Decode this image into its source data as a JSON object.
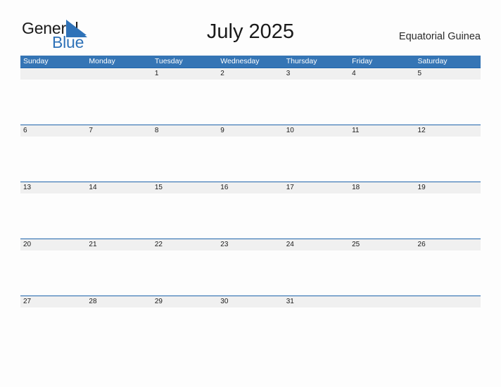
{
  "brand": {
    "name_part1": "General",
    "name_part2": "Blue",
    "flag_icon": "triangle-flag-icon",
    "accent_color": "#2e72b8"
  },
  "header": {
    "title": "July 2025",
    "region": "Equatorial Guinea"
  },
  "theme": {
    "header_row_bg": "#3575b5",
    "rule_color": "#1f64ab",
    "band_bg": "#f0f0f0",
    "page_bg": "#fdfdfd",
    "text_color": "#1a1a1a"
  },
  "calendar": {
    "month": "July",
    "year": "2025",
    "weekdays": [
      "Sunday",
      "Monday",
      "Tuesday",
      "Wednesday",
      "Thursday",
      "Friday",
      "Saturday"
    ],
    "weeks": [
      [
        "",
        "",
        "1",
        "2",
        "3",
        "4",
        "5"
      ],
      [
        "6",
        "7",
        "8",
        "9",
        "10",
        "11",
        "12"
      ],
      [
        "13",
        "14",
        "15",
        "16",
        "17",
        "18",
        "19"
      ],
      [
        "20",
        "21",
        "22",
        "23",
        "24",
        "25",
        "26"
      ],
      [
        "27",
        "28",
        "29",
        "30",
        "31",
        "",
        ""
      ]
    ]
  }
}
